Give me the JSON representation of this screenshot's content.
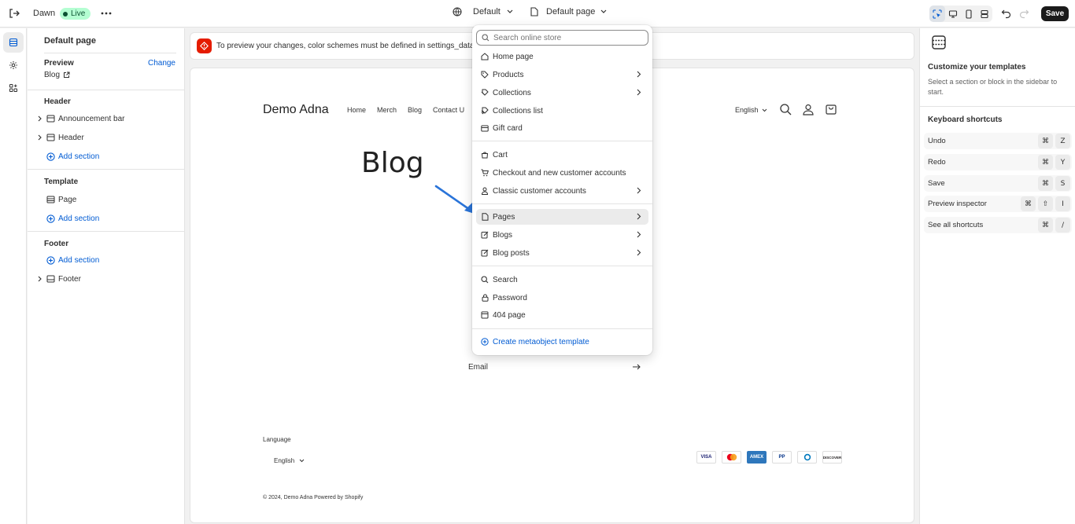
{
  "topbar": {
    "theme_name": "Dawn",
    "live_badge": "Live",
    "color_scheme": "Default",
    "template_select": "Default page",
    "save_label": "Save"
  },
  "sidebar": {
    "title": "Default page",
    "preview_label": "Preview",
    "change_link": "Change",
    "preview_value": "Blog",
    "header_group": "Header",
    "header_items": [
      "Announcement bar",
      "Header"
    ],
    "add_section": "Add section",
    "template_group": "Template",
    "template_items": [
      "Page"
    ],
    "footer_group": "Footer",
    "footer_items": [
      "Footer"
    ]
  },
  "banner": {
    "text": "To preview your changes, color schemes must be defined in settings_data and"
  },
  "store": {
    "logo": "Demo Adna",
    "nav": [
      "Home",
      "Merch",
      "Blog",
      "Contact U"
    ],
    "language": "English",
    "page_title": "Blog",
    "email_label": "Email",
    "footer_language_label": "Language",
    "footer_language": "English",
    "payments": [
      "VISA",
      "MC",
      "AMEX",
      "PP",
      "DC",
      "DISCOVER"
    ],
    "copyright": "© 2024, Demo Adna Powered by Shopify"
  },
  "dropdown": {
    "search_placeholder": "Search online store",
    "items": [
      {
        "label": "Home page",
        "icon": "home-icon",
        "submenu": false
      },
      {
        "label": "Products",
        "icon": "tag-icon",
        "submenu": true
      },
      {
        "label": "Collections",
        "icon": "collection-icon",
        "submenu": true
      },
      {
        "label": "Collections list",
        "icon": "collections-list-icon",
        "submenu": false
      },
      {
        "label": "Gift card",
        "icon": "gift-card-icon",
        "submenu": false
      },
      {
        "label": "Cart",
        "icon": "cart-icon",
        "submenu": false
      },
      {
        "label": "Checkout and new customer accounts",
        "icon": "checkout-icon",
        "submenu": false
      },
      {
        "label": "Classic customer accounts",
        "icon": "person-icon",
        "submenu": true
      },
      {
        "label": "Pages",
        "icon": "page-icon",
        "submenu": true
      },
      {
        "label": "Blogs",
        "icon": "blog-icon",
        "submenu": true
      },
      {
        "label": "Blog posts",
        "icon": "blog-post-icon",
        "submenu": true
      },
      {
        "label": "Search",
        "icon": "search-icon",
        "submenu": false
      },
      {
        "label": "Password",
        "icon": "lock-icon",
        "submenu": false
      },
      {
        "label": "404 page",
        "icon": "page-404-icon",
        "submenu": false
      },
      {
        "label": "Create metaobject template",
        "icon": "plus-circle-icon",
        "submenu": false
      }
    ]
  },
  "right_panel": {
    "title": "Customize your templates",
    "description": "Select a section or block in the sidebar to start.",
    "shortcuts_title": "Keyboard shortcuts",
    "shortcuts": [
      {
        "label": "Undo",
        "keys": [
          "⌘",
          "Z"
        ]
      },
      {
        "label": "Redo",
        "keys": [
          "⌘",
          "Y"
        ]
      },
      {
        "label": "Save",
        "keys": [
          "⌘",
          "S"
        ]
      },
      {
        "label": "Preview inspector",
        "keys": [
          "⌘",
          "⇧",
          "I"
        ]
      },
      {
        "label": "See all shortcuts",
        "keys": [
          "⌘",
          "/"
        ]
      }
    ]
  },
  "colors": {
    "accent_link": "#005bd3",
    "live_badge_bg": "#b4fed2",
    "warning_red": "#e51c00",
    "annotation_arrow": "#2a74d9"
  }
}
